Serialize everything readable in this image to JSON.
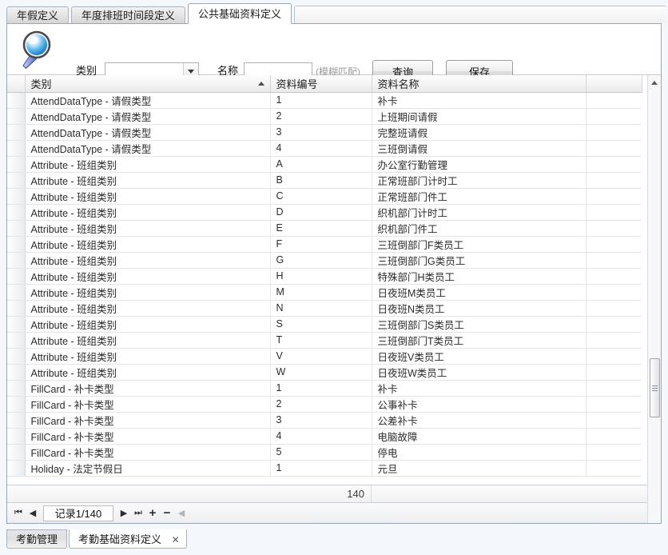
{
  "window": {
    "title": "公共基础资料定义"
  },
  "top_tabs": [
    {
      "label": "年假定义",
      "active": false
    },
    {
      "label": "年度排班时间段定义",
      "active": false
    },
    {
      "label": "公共基础资料定义",
      "active": true
    }
  ],
  "toolbar": {
    "search_icon": "magnifier-icon",
    "category_label": "类别",
    "category_value": "",
    "name_label": "名称",
    "name_value": "",
    "fuzzy_hint": "(模糊匹配)",
    "query_button": "查询",
    "save_button": "保存"
  },
  "grid": {
    "columns": [
      {
        "key": "selector",
        "label": "",
        "sort": ""
      },
      {
        "key": "category",
        "label": "类别",
        "sort": "asc"
      },
      {
        "key": "code",
        "label": "资料编号",
        "sort": ""
      },
      {
        "key": "name",
        "label": "资料名称",
        "sort": ""
      },
      {
        "key": "pad",
        "label": "",
        "sort": ""
      }
    ],
    "rows": [
      {
        "category": "AttendDataType - 请假类型",
        "code": "1",
        "name": "补卡"
      },
      {
        "category": "AttendDataType - 请假类型",
        "code": "2",
        "name": "上班期间请假"
      },
      {
        "category": "AttendDataType - 请假类型",
        "code": "3",
        "name": "完整班请假"
      },
      {
        "category": "AttendDataType - 请假类型",
        "code": "4",
        "name": "三班倒请假"
      },
      {
        "category": "Attribute - 班组类别",
        "code": "A",
        "name": "办公室行勤管理"
      },
      {
        "category": "Attribute - 班组类别",
        "code": "B",
        "name": "正常班部门计时工"
      },
      {
        "category": "Attribute - 班组类别",
        "code": "C",
        "name": "正常班部门件工"
      },
      {
        "category": "Attribute - 班组类别",
        "code": "D",
        "name": "织机部门计时工"
      },
      {
        "category": "Attribute - 班组类别",
        "code": "E",
        "name": "织机部门件工"
      },
      {
        "category": "Attribute - 班组类别",
        "code": "F",
        "name": "三班倒部门F类员工"
      },
      {
        "category": "Attribute - 班组类别",
        "code": "G",
        "name": "三班倒部门G类员工"
      },
      {
        "category": "Attribute - 班组类别",
        "code": "H",
        "name": "特殊部门H类员工"
      },
      {
        "category": "Attribute - 班组类别",
        "code": "M",
        "name": "日夜班M类员工"
      },
      {
        "category": "Attribute - 班组类别",
        "code": "N",
        "name": "日夜班N类员工"
      },
      {
        "category": "Attribute - 班组类别",
        "code": "S",
        "name": "三班倒部门S类员工"
      },
      {
        "category": "Attribute - 班组类别",
        "code": "T",
        "name": "三班倒部门T类员工"
      },
      {
        "category": "Attribute - 班组类别",
        "code": "V",
        "name": "日夜班V类员工"
      },
      {
        "category": "Attribute - 班组类别",
        "code": "W",
        "name": "日夜班W类员工"
      },
      {
        "category": "FillCard - 补卡类型",
        "code": "1",
        "name": "补卡"
      },
      {
        "category": "FillCard - 补卡类型",
        "code": "2",
        "name": "公事补卡"
      },
      {
        "category": "FillCard - 补卡类型",
        "code": "3",
        "name": "公差补卡"
      },
      {
        "category": "FillCard - 补卡类型",
        "code": "4",
        "name": "电脑故障"
      },
      {
        "category": "FillCard - 补卡类型",
        "code": "5",
        "name": "停电"
      },
      {
        "category": "Holiday - 法定节假日",
        "code": "1",
        "name": "元旦"
      }
    ],
    "summary_count": "140"
  },
  "navigator": {
    "first_label": "⏮",
    "prev_label": "◀",
    "record_label": "记录1/140",
    "next_label": "▶",
    "last_label": "⏭",
    "add_label": "+",
    "delete_label": "−",
    "more_label": "◀"
  },
  "taskbar": {
    "tabs": [
      {
        "label": "考勤管理",
        "active": false,
        "closable": false
      },
      {
        "label": "考勤基础资料定义",
        "active": true,
        "closable": true,
        "close_label": "✕"
      }
    ]
  },
  "colors": {
    "accent": "#3b82c4",
    "panel_border": "#9aa6b2",
    "grid_line": "#e3e6e9",
    "header_text": "#1a1a1a"
  }
}
